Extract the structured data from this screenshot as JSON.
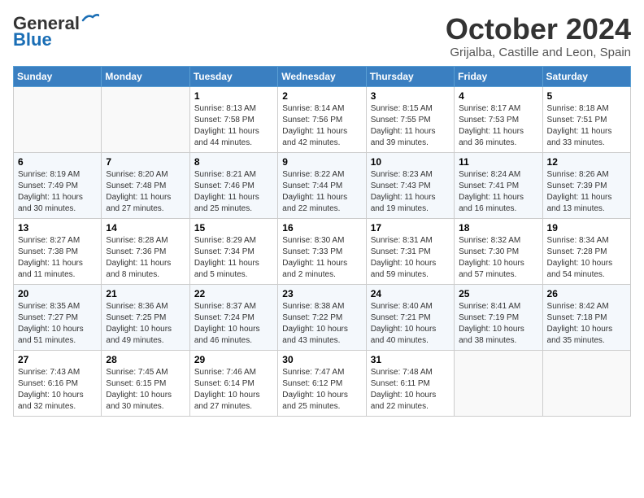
{
  "header": {
    "logo_line1": "General",
    "logo_line2": "Blue",
    "month": "October 2024",
    "location": "Grijalba, Castille and Leon, Spain"
  },
  "weekdays": [
    "Sunday",
    "Monday",
    "Tuesday",
    "Wednesday",
    "Thursday",
    "Friday",
    "Saturday"
  ],
  "weeks": [
    [
      {
        "day": "",
        "info": ""
      },
      {
        "day": "",
        "info": ""
      },
      {
        "day": "1",
        "info": "Sunrise: 8:13 AM\nSunset: 7:58 PM\nDaylight: 11 hours and 44 minutes."
      },
      {
        "day": "2",
        "info": "Sunrise: 8:14 AM\nSunset: 7:56 PM\nDaylight: 11 hours and 42 minutes."
      },
      {
        "day": "3",
        "info": "Sunrise: 8:15 AM\nSunset: 7:55 PM\nDaylight: 11 hours and 39 minutes."
      },
      {
        "day": "4",
        "info": "Sunrise: 8:17 AM\nSunset: 7:53 PM\nDaylight: 11 hours and 36 minutes."
      },
      {
        "day": "5",
        "info": "Sunrise: 8:18 AM\nSunset: 7:51 PM\nDaylight: 11 hours and 33 minutes."
      }
    ],
    [
      {
        "day": "6",
        "info": "Sunrise: 8:19 AM\nSunset: 7:49 PM\nDaylight: 11 hours and 30 minutes."
      },
      {
        "day": "7",
        "info": "Sunrise: 8:20 AM\nSunset: 7:48 PM\nDaylight: 11 hours and 27 minutes."
      },
      {
        "day": "8",
        "info": "Sunrise: 8:21 AM\nSunset: 7:46 PM\nDaylight: 11 hours and 25 minutes."
      },
      {
        "day": "9",
        "info": "Sunrise: 8:22 AM\nSunset: 7:44 PM\nDaylight: 11 hours and 22 minutes."
      },
      {
        "day": "10",
        "info": "Sunrise: 8:23 AM\nSunset: 7:43 PM\nDaylight: 11 hours and 19 minutes."
      },
      {
        "day": "11",
        "info": "Sunrise: 8:24 AM\nSunset: 7:41 PM\nDaylight: 11 hours and 16 minutes."
      },
      {
        "day": "12",
        "info": "Sunrise: 8:26 AM\nSunset: 7:39 PM\nDaylight: 11 hours and 13 minutes."
      }
    ],
    [
      {
        "day": "13",
        "info": "Sunrise: 8:27 AM\nSunset: 7:38 PM\nDaylight: 11 hours and 11 minutes."
      },
      {
        "day": "14",
        "info": "Sunrise: 8:28 AM\nSunset: 7:36 PM\nDaylight: 11 hours and 8 minutes."
      },
      {
        "day": "15",
        "info": "Sunrise: 8:29 AM\nSunset: 7:34 PM\nDaylight: 11 hours and 5 minutes."
      },
      {
        "day": "16",
        "info": "Sunrise: 8:30 AM\nSunset: 7:33 PM\nDaylight: 11 hours and 2 minutes."
      },
      {
        "day": "17",
        "info": "Sunrise: 8:31 AM\nSunset: 7:31 PM\nDaylight: 10 hours and 59 minutes."
      },
      {
        "day": "18",
        "info": "Sunrise: 8:32 AM\nSunset: 7:30 PM\nDaylight: 10 hours and 57 minutes."
      },
      {
        "day": "19",
        "info": "Sunrise: 8:34 AM\nSunset: 7:28 PM\nDaylight: 10 hours and 54 minutes."
      }
    ],
    [
      {
        "day": "20",
        "info": "Sunrise: 8:35 AM\nSunset: 7:27 PM\nDaylight: 10 hours and 51 minutes."
      },
      {
        "day": "21",
        "info": "Sunrise: 8:36 AM\nSunset: 7:25 PM\nDaylight: 10 hours and 49 minutes."
      },
      {
        "day": "22",
        "info": "Sunrise: 8:37 AM\nSunset: 7:24 PM\nDaylight: 10 hours and 46 minutes."
      },
      {
        "day": "23",
        "info": "Sunrise: 8:38 AM\nSunset: 7:22 PM\nDaylight: 10 hours and 43 minutes."
      },
      {
        "day": "24",
        "info": "Sunrise: 8:40 AM\nSunset: 7:21 PM\nDaylight: 10 hours and 40 minutes."
      },
      {
        "day": "25",
        "info": "Sunrise: 8:41 AM\nSunset: 7:19 PM\nDaylight: 10 hours and 38 minutes."
      },
      {
        "day": "26",
        "info": "Sunrise: 8:42 AM\nSunset: 7:18 PM\nDaylight: 10 hours and 35 minutes."
      }
    ],
    [
      {
        "day": "27",
        "info": "Sunrise: 7:43 AM\nSunset: 6:16 PM\nDaylight: 10 hours and 32 minutes."
      },
      {
        "day": "28",
        "info": "Sunrise: 7:45 AM\nSunset: 6:15 PM\nDaylight: 10 hours and 30 minutes."
      },
      {
        "day": "29",
        "info": "Sunrise: 7:46 AM\nSunset: 6:14 PM\nDaylight: 10 hours and 27 minutes."
      },
      {
        "day": "30",
        "info": "Sunrise: 7:47 AM\nSunset: 6:12 PM\nDaylight: 10 hours and 25 minutes."
      },
      {
        "day": "31",
        "info": "Sunrise: 7:48 AM\nSunset: 6:11 PM\nDaylight: 10 hours and 22 minutes."
      },
      {
        "day": "",
        "info": ""
      },
      {
        "day": "",
        "info": ""
      }
    ]
  ]
}
